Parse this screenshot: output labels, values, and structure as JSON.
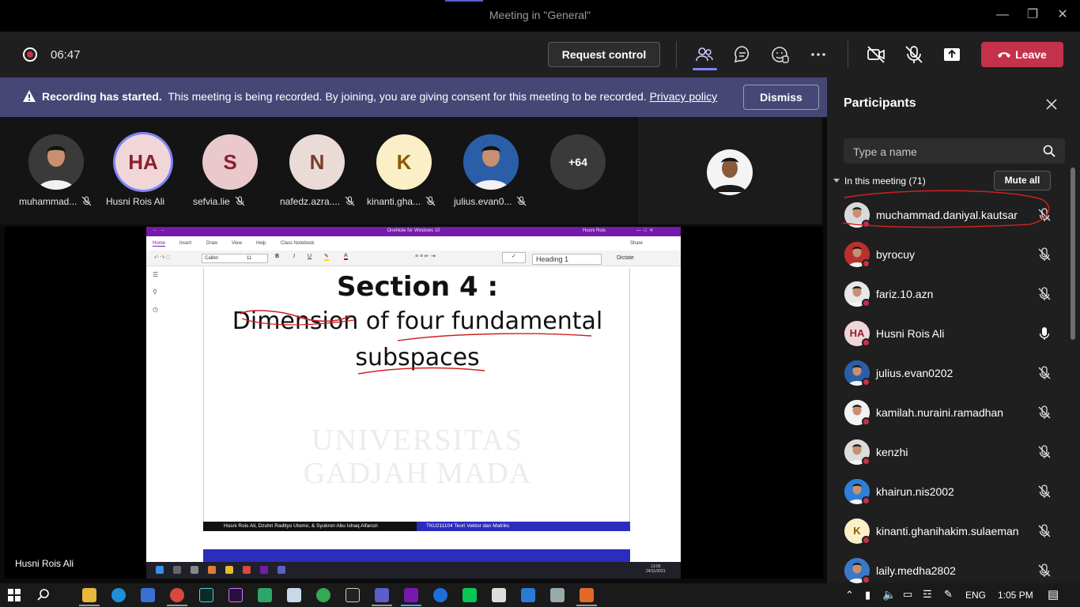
{
  "window": {
    "title": "Meeting in \"General\""
  },
  "toolbar": {
    "timer": "06:47",
    "request_control": "Request control",
    "leave": "Leave"
  },
  "banner": {
    "bold": "Recording has started.",
    "text": "This meeting is being recorded. By joining, you are giving consent for this meeting to be recorded.",
    "link": "Privacy policy",
    "dismiss": "Dismiss"
  },
  "gallery": [
    {
      "name": "muhammad...",
      "initials": "",
      "bg": "#3a3a3a",
      "fg": "#ffffff",
      "photo": true
    },
    {
      "name": "Husni Rois Ali",
      "initials": "HA",
      "bg": "#f0d6d8",
      "fg": "#8b2030",
      "photo": false
    },
    {
      "name": "sefvia.lie",
      "initials": "S",
      "bg": "#e9c9cc",
      "fg": "#8b2030",
      "photo": false
    },
    {
      "name": "nafedz.azra....",
      "initials": "N",
      "bg": "#eadbd6",
      "fg": "#7a3b2a",
      "photo": false
    },
    {
      "name": "kinanti.gha...",
      "initials": "K",
      "bg": "#fbefc8",
      "fg": "#8a5a00",
      "photo": false
    },
    {
      "name": "julius.evan0...",
      "initials": "",
      "bg": "#2b5ea8",
      "fg": "#ffffff",
      "photo": true
    }
  ],
  "gallery_more": "+64",
  "video": {
    "presenter_name": "Husni Rois Ali",
    "onenote": {
      "title": "OneNote for Windows 10",
      "user": "Husni Rois",
      "tabs": [
        "Home",
        "Insert",
        "Draw",
        "View",
        "Help",
        "Class Notebook"
      ],
      "font": "Calibri",
      "font_size": "11",
      "style": "Heading 1",
      "dictate": "Dictate",
      "share": "Share"
    },
    "slide": {
      "title": "Section 4 :",
      "line1": "Dimension of four fundamental",
      "line2": "subspaces",
      "watermark1": "UNIVERSITAS",
      "watermark2": "GADJAH MADA",
      "footer_left": "Husni Rois Ali, Dzuhri Radityo Utomo,  & Syukron Abu Ishaq Alfarozi",
      "footer_right": "TKU211104 Teori Vektor dan Matriks"
    },
    "inner_clock": {
      "time": "13:05",
      "date": "24/11/2021"
    }
  },
  "participants": {
    "title": "Participants",
    "search_placeholder": "Type a name",
    "section": "In this meeting (71)",
    "mute_all": "Mute all",
    "list": [
      {
        "name": "muchammad.daniyal.kautsar",
        "initials": "",
        "bg": "#d9d9d9",
        "mic": "off"
      },
      {
        "name": "byrocuy",
        "initials": "",
        "bg": "#b8312f",
        "mic": "off"
      },
      {
        "name": "fariz.10.azn",
        "initials": "",
        "bg": "#e8e8e8",
        "mic": "off"
      },
      {
        "name": "Husni Rois Ali",
        "initials": "HA",
        "bg": "#f0d6d8",
        "mic": "on"
      },
      {
        "name": "julius.evan0202",
        "initials": "",
        "bg": "#2b5ea8",
        "mic": "off"
      },
      {
        "name": "kamilah.nuraini.ramadhan",
        "initials": "",
        "bg": "#f2f2f2",
        "mic": "off"
      },
      {
        "name": "kenzhi",
        "initials": "",
        "bg": "#dcdcdc",
        "mic": "off"
      },
      {
        "name": "khairun.nis2002",
        "initials": "",
        "bg": "#2f7fd8",
        "mic": "off"
      },
      {
        "name": "kinanti.ghanihakim.sulaeman",
        "initials": "K",
        "bg": "#fbefc8",
        "mic": "off"
      },
      {
        "name": "laily.medha2802",
        "initials": "",
        "bg": "#3a78c8",
        "mic": "off"
      }
    ]
  },
  "taskbar": {
    "lang": "ENG",
    "time": "1:05 PM"
  }
}
